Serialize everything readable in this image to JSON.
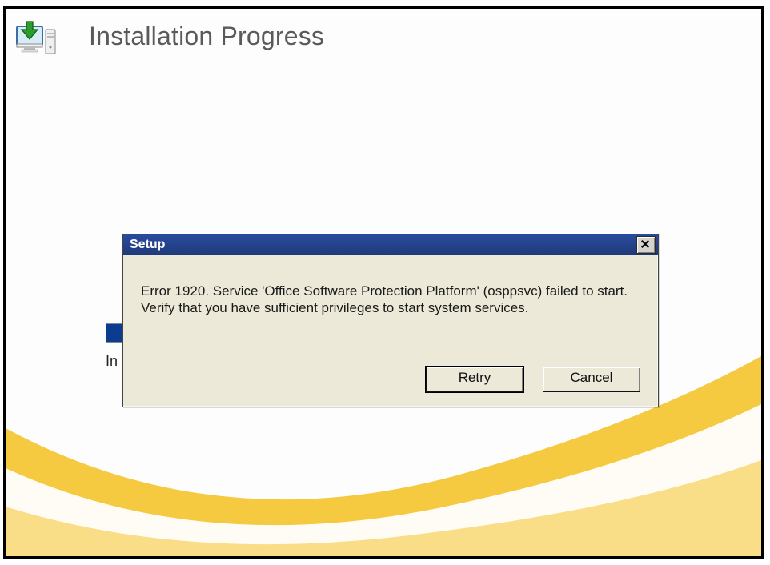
{
  "header": {
    "title": "Installation Progress"
  },
  "background": {
    "status_fragment": "In"
  },
  "dialog": {
    "title": "Setup",
    "message": "Error 1920. Service 'Office Software Protection Platform' (osppsvc) failed to start.  Verify that you have sufficient privileges to start system services.",
    "retry_label": "Retry",
    "cancel_label": "Cancel"
  }
}
